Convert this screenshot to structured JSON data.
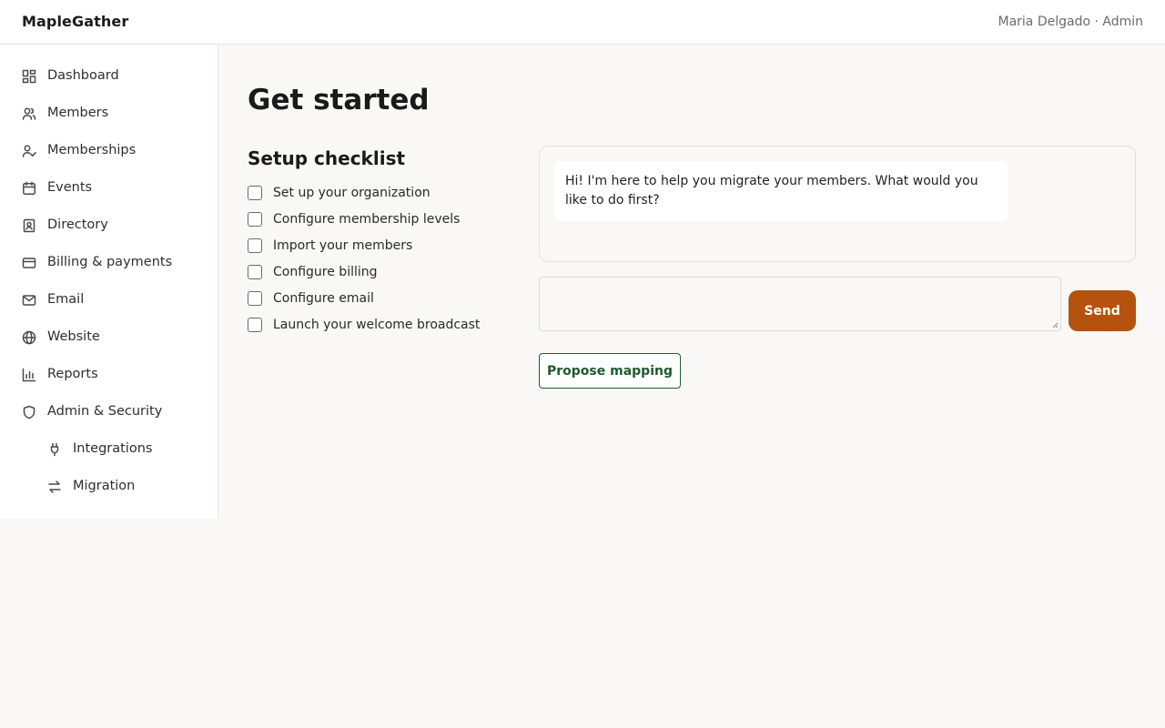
{
  "header": {
    "brand": "MapleGather",
    "user": "Maria Delgado · Admin"
  },
  "sidebar": {
    "items": [
      {
        "label": "Dashboard",
        "icon": "dashboard-icon"
      },
      {
        "label": "Members",
        "icon": "members-icon"
      },
      {
        "label": "Memberships",
        "icon": "memberships-icon"
      },
      {
        "label": "Events",
        "icon": "calendar-icon"
      },
      {
        "label": "Directory",
        "icon": "directory-icon"
      },
      {
        "label": "Billing & payments",
        "icon": "credit-card-icon"
      },
      {
        "label": "Email",
        "icon": "mail-icon"
      },
      {
        "label": "Website",
        "icon": "globe-icon"
      },
      {
        "label": "Reports",
        "icon": "bar-chart-icon"
      },
      {
        "label": "Admin & Security",
        "icon": "shield-icon"
      }
    ],
    "subitems": [
      {
        "label": "Integrations",
        "icon": "plug-icon"
      },
      {
        "label": "Migration",
        "icon": "arrows-swap-icon"
      }
    ]
  },
  "main": {
    "title": "Get started",
    "checklist_title": "Setup checklist",
    "checklist": [
      "Set up your organization",
      "Configure membership levels",
      "Import your members",
      "Configure billing",
      "Configure email",
      "Launch your welcome broadcast"
    ]
  },
  "chat": {
    "message": "Hi! I'm here to help you migrate your members. What would you like to do first?",
    "input_value": "",
    "send_label": "Send",
    "propose_label": "Propose mapping"
  },
  "colors": {
    "accent": "#b5520e",
    "secondary": "#1f5a2e",
    "background": "#f9f8f6"
  }
}
